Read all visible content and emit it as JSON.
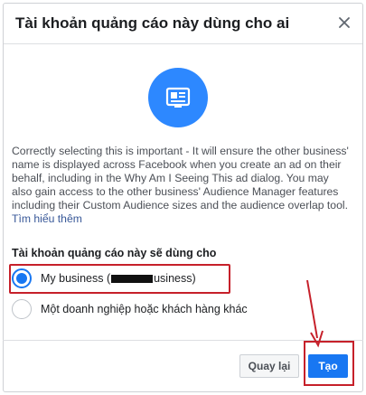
{
  "dialog": {
    "title": "Tài khoản quảng cáo này dùng cho ai",
    "close_icon": "close-icon",
    "hero_icon": "ad-screen-icon",
    "description": "Correctly selecting this is important - It will ensure the other business' name is displayed across Facebook when you create an ad on their behalf, including in the Why Am I Seeing This ad dialog. You may also gain access to the other business' Audience Manager features including their Custom Audience sizes and the audience overlap tool.",
    "learn_more": "Tìm hiểu thêm",
    "section_label": "Tài khoản quảng cáo này sẽ dùng cho",
    "options": [
      {
        "label_prefix": "My business (",
        "label_suffix": "usiness)",
        "selected": true
      },
      {
        "label": "Một doanh nghiệp hoặc khách hàng khác",
        "selected": false
      }
    ],
    "buttons": {
      "back": "Quay lại",
      "create": "Tạo"
    }
  },
  "colors": {
    "accent": "#1877f2",
    "hero_bg": "#2d88ff",
    "annotation": "#c6202a"
  }
}
